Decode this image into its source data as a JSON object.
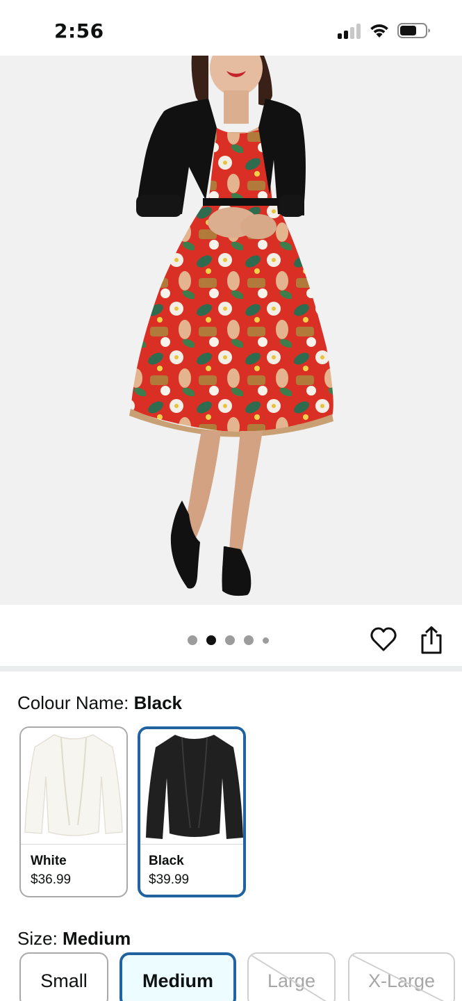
{
  "status_bar": {
    "time": "2:56"
  },
  "gallery": {
    "image_count": 5,
    "active_index": 1
  },
  "colour": {
    "label": "Colour Name: ",
    "selected": "Black",
    "options": [
      {
        "name": "White",
        "price": "$36.99"
      },
      {
        "name": "Black",
        "price": "$39.99"
      }
    ]
  },
  "size": {
    "label": "Size: ",
    "selected": "Medium",
    "options": [
      {
        "name": "Small",
        "available": true
      },
      {
        "name": "Medium",
        "available": true
      },
      {
        "name": "Large",
        "available": false
      },
      {
        "name": "X-Large",
        "available": false
      }
    ]
  },
  "colors": {
    "accent": "#2162a1",
    "selected_bg": "#edfdff"
  },
  "icons": [
    "cellular-signal-icon",
    "wifi-icon",
    "battery-icon",
    "heart-icon",
    "share-icon"
  ]
}
